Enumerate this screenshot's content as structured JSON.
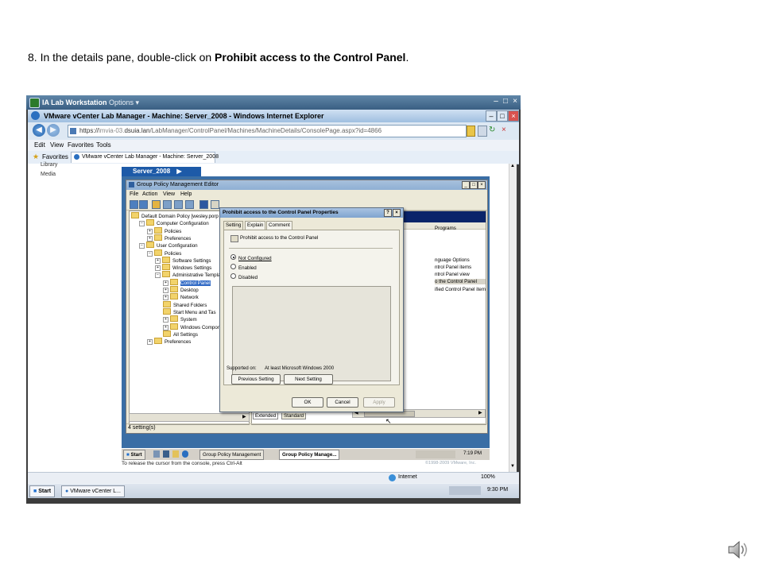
{
  "instruction": {
    "prefix": "8. In the details pane, double-click on ",
    "bold": "Prohibit access to the Control Panel",
    "suffix": "."
  },
  "ia_bar": {
    "title": "IA Lab Workstation",
    "options": "Options ▾"
  },
  "ie": {
    "title": "VMware vCenter Lab Manager - Machine: Server_2008 - Windows Internet Explorer",
    "url_prefix": "https://",
    "url_host": "dsuia.lan",
    "url_rest": "/LabManager/ControlPanel/Machines/MachineDetails/ConsolePage.aspx?id=4866",
    "menu": [
      "Edit",
      "View",
      "Favorites",
      "Tools"
    ],
    "favorites_label": "Favorites",
    "tab_label": "VMware vCenter Lab Manager - Machine: Server_2008",
    "status_zone": "Internet",
    "zoom": "100%"
  },
  "lab_manager": {
    "side_items": [
      "Library",
      "Media"
    ],
    "server_tab": "Server_2008",
    "release_hint": "To release the cursor from the console, press Ctrl-Alt",
    "copyright": "©1998-2009 VMware, Inc."
  },
  "gpme": {
    "title": "Group Policy Management Editor",
    "menu": [
      "File",
      "Action",
      "View",
      "Help"
    ],
    "tree": [
      {
        "label": "Default Domain Policy [wesley.porp",
        "indent": 0,
        "expander": ""
      },
      {
        "label": "Computer Configuration",
        "indent": 1,
        "expander": "−"
      },
      {
        "label": "Policies",
        "indent": 2,
        "expander": "+"
      },
      {
        "label": "Preferences",
        "indent": 2,
        "expander": "+"
      },
      {
        "label": "User Configuration",
        "indent": 1,
        "expander": "−"
      },
      {
        "label": "Policies",
        "indent": 2,
        "expander": "−"
      },
      {
        "label": "Software Settings",
        "indent": 3,
        "expander": "+"
      },
      {
        "label": "Windows Settings",
        "indent": 3,
        "expander": "+"
      },
      {
        "label": "Administrative Template",
        "indent": 3,
        "expander": "−"
      },
      {
        "label": "Control Panel",
        "indent": 4,
        "expander": "+",
        "selected": true
      },
      {
        "label": "Desktop",
        "indent": 4,
        "expander": "+"
      },
      {
        "label": "Network",
        "indent": 4,
        "expander": "+"
      },
      {
        "label": "Shared Folders",
        "indent": 4,
        "expander": ""
      },
      {
        "label": "Start Menu and Tas",
        "indent": 4,
        "expander": ""
      },
      {
        "label": "System",
        "indent": 4,
        "expander": "+"
      },
      {
        "label": "Windows Componen",
        "indent": 4,
        "expander": "+"
      },
      {
        "label": "All Settings",
        "indent": 4,
        "expander": ""
      },
      {
        "label": "Preferences",
        "indent": 2,
        "expander": "+"
      }
    ],
    "details": [
      "Programs",
      "nguage Options",
      "ntrol Panel items",
      "ntrol Panel view",
      "o the Control Panel",
      "ified Control Panel items"
    ],
    "bottom_tabs": [
      "Extended",
      "Standard"
    ],
    "status": "4 setting(s)"
  },
  "dialog": {
    "title": "Prohibit access to the Control Panel Properties",
    "tabs": [
      "Setting",
      "Explain",
      "Comment"
    ],
    "setting_name": "Prohibit access to the Control Panel",
    "options": [
      "Not Configured",
      "Enabled",
      "Disabled"
    ],
    "selected_option": "Not Configured",
    "supported_on_label": "Supported on:",
    "supported_on_value": "At least Microsoft Windows 2000",
    "prev_button": "Previous Setting",
    "next_button": "Next Setting",
    "ok_button": "OK",
    "cancel_button": "Cancel",
    "apply_button": "Apply"
  },
  "guest_taskbar": {
    "start": "Start",
    "items": [
      "Group Policy Management",
      "Group Policy Manage..."
    ],
    "clock": "7:19 PM"
  },
  "host_taskbar": {
    "start": "Start",
    "items": [
      "VMware vCenter L..."
    ],
    "clock": "9:30 PM"
  }
}
